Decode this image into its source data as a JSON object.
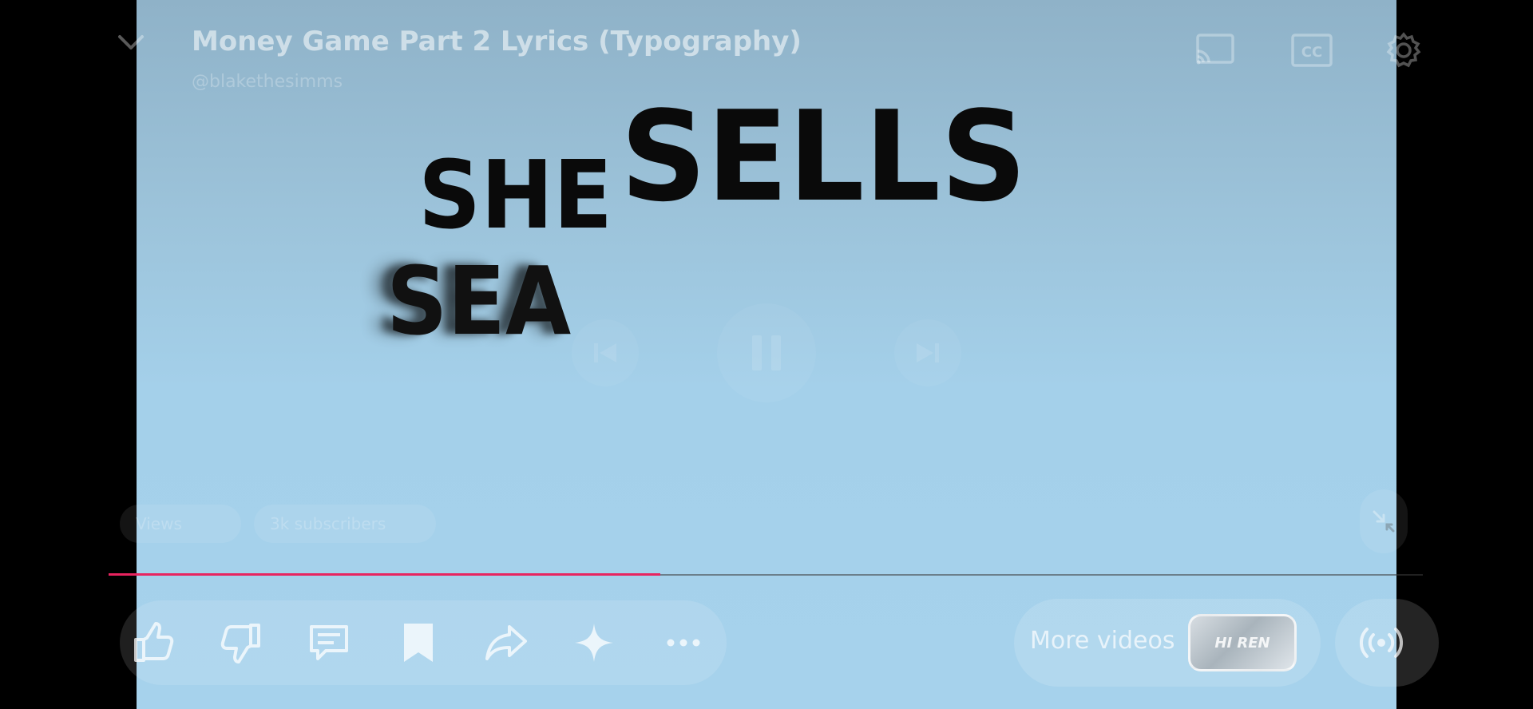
{
  "video": {
    "title": "Money Game Part 2 Lyrics (Typography)",
    "channel_handle": "@blakethesimms",
    "background_color": "#a4d0ea",
    "lyrics": {
      "word1": "SHE",
      "word2": "SELLS",
      "word3": "SEA"
    }
  },
  "top_controls": {
    "collapse_icon": "chevron-down-icon",
    "cast_icon": "cast-icon",
    "captions_label": "CC",
    "settings_icon": "gear-icon"
  },
  "center_controls": {
    "previous_icon": "skip-previous-icon",
    "play_state_icon": "pause-icon",
    "next_icon": "skip-next-icon"
  },
  "chips": [
    {
      "label": "Views"
    },
    {
      "label": "3k subscribers"
    }
  ],
  "progress": {
    "fraction": 0.42,
    "color": "#e8245f"
  },
  "actions": [
    {
      "name": "like",
      "icon": "thumbs-up-icon"
    },
    {
      "name": "dislike",
      "icon": "thumbs-down-icon"
    },
    {
      "name": "comments",
      "icon": "comment-icon"
    },
    {
      "name": "save",
      "icon": "bookmark-icon"
    },
    {
      "name": "share",
      "icon": "share-icon"
    },
    {
      "name": "ask",
      "icon": "sparkle-icon"
    },
    {
      "name": "more",
      "icon": "more-horizontal-icon"
    }
  ],
  "more_videos": {
    "label": "More videos",
    "thumbnail_text": "HI REN"
  },
  "live_icon": "broadcast-icon",
  "minimize_icon": "minimize-icon"
}
